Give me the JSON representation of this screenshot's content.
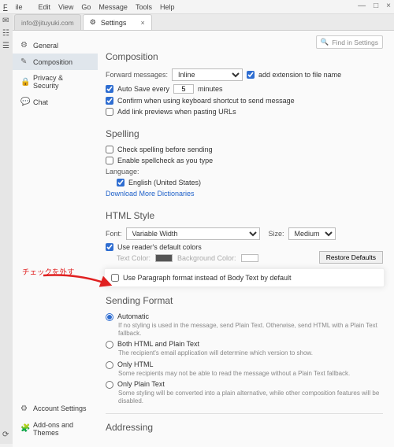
{
  "menu": {
    "file": "File",
    "edit": "Edit",
    "view": "View",
    "go": "Go",
    "message": "Message",
    "tools": "Tools",
    "help": "Help"
  },
  "tabs": {
    "inbox": "info@jituyuki.com",
    "settings": "Settings"
  },
  "search": {
    "placeholder": "Find in Settings"
  },
  "sidebar": {
    "general": "General",
    "composition": "Composition",
    "privacy": "Privacy & Security",
    "chat": "Chat",
    "account": "Account Settings",
    "addons": "Add-ons and Themes"
  },
  "composition": {
    "title": "Composition",
    "forward_label": "Forward messages:",
    "forward_value": "Inline",
    "add_ext": "add extension to file name",
    "autosave_a": "Auto Save every",
    "autosave_val": "5",
    "autosave_b": "minutes",
    "confirm_shortcut": "Confirm when using keyboard shortcut to send message",
    "link_previews": "Add link previews when pasting URLs"
  },
  "spelling": {
    "title": "Spelling",
    "before_send": "Check spelling before sending",
    "as_type": "Enable spellcheck as you type",
    "lang_label": "Language:",
    "lang_value": "English (United States)",
    "download": "Download More Dictionaries"
  },
  "html": {
    "title": "HTML Style",
    "font_label": "Font:",
    "font_value": "Variable Width",
    "size_label": "Size:",
    "size_value": "Medium",
    "use_colors": "Use reader's default colors",
    "text_color": "Text Color:",
    "bg_color": "Background Color:",
    "restore": "Restore Defaults",
    "paragraph": "Use Paragraph format instead of Body Text by default"
  },
  "sending": {
    "title": "Sending Format",
    "auto": "Automatic",
    "auto_desc": "If no styling is used in the message, send Plain Text. Otherwise, send HTML with a Plain Text fallback.",
    "both": "Both HTML and Plain Text",
    "both_desc": "The recipient's email application will determine which version to show.",
    "html": "Only HTML",
    "html_desc": "Some recipients may not be able to read the message without a Plain Text fallback.",
    "plain": "Only Plain Text",
    "plain_desc": "Some styling will be converted into a plain alternative, while other composition features will be disabled."
  },
  "addressing": {
    "title": "Addressing"
  },
  "annotation": "チェックを外す"
}
